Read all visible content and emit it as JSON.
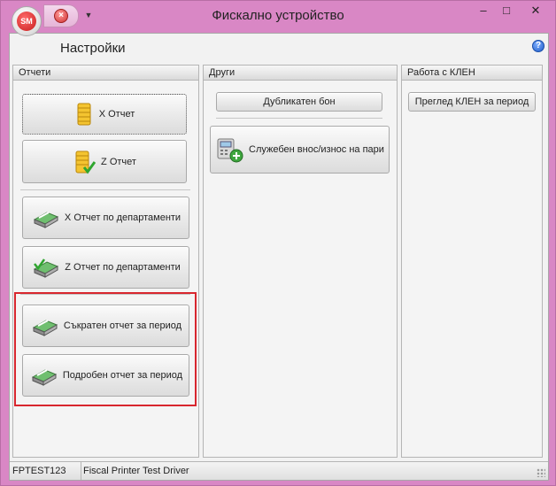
{
  "window": {
    "title": "Фискално устройство",
    "orb_text": "SM",
    "minimize": "–",
    "maximize": "□",
    "close": "✕"
  },
  "page": {
    "title": "Настройки",
    "help": "?"
  },
  "panels": {
    "reports": {
      "header": "Отчети",
      "x_report": "X Отчет",
      "z_report": "Z Отчет",
      "x_dept": "X Отчет по департаменти",
      "z_dept": "Z Отчет по департаменти",
      "short_period": "Съкратен отчет за период",
      "detailed_period": "Подробен отчет за период"
    },
    "other": {
      "header": "Други",
      "duplicate": "Дубликатен бон",
      "cash_io": "Служебен внос/износ на пари"
    },
    "klen": {
      "header": "Работа с КЛЕН",
      "review": "Преглед КЛЕН за период"
    }
  },
  "status": {
    "device": "FPTEST123",
    "driver": "Fiscal Printer Test Driver"
  },
  "colors": {
    "window_bg": "#d987c5",
    "highlight": "#d8262e"
  }
}
